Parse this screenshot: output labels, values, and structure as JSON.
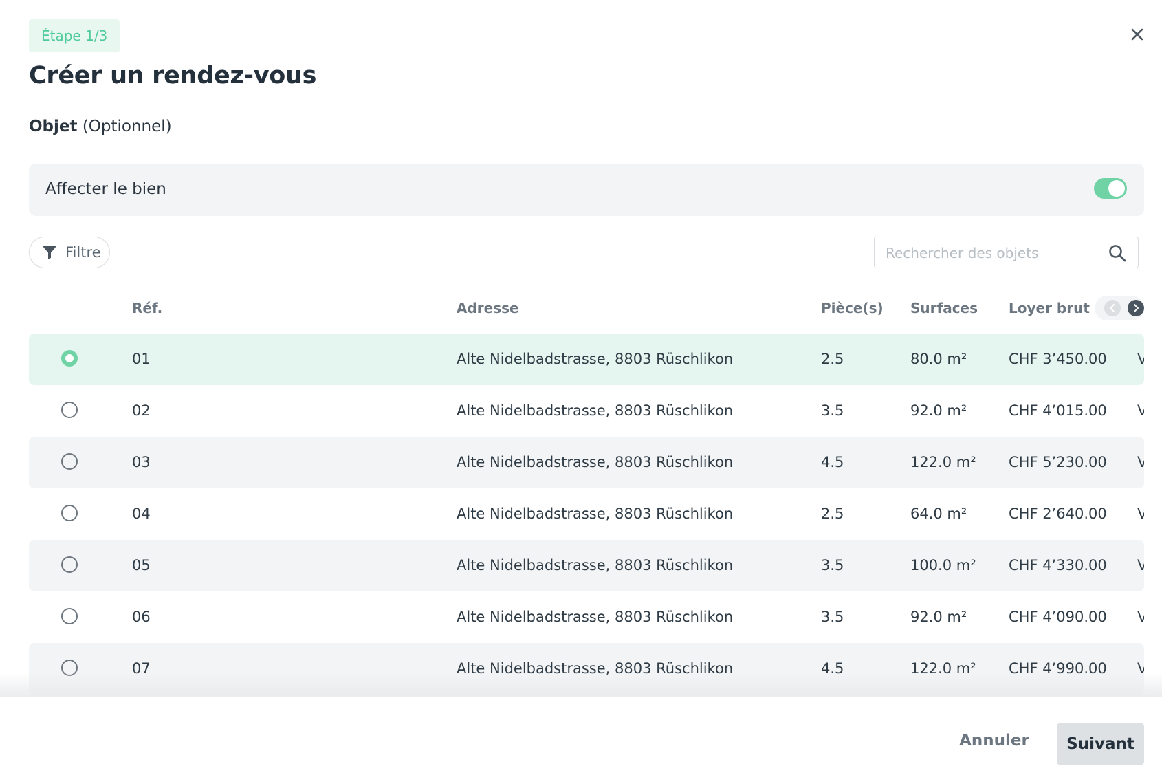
{
  "modal": {
    "step": "Étape 1/3",
    "title": "Créer un rendez-vous",
    "section_label_strong": "Objet",
    "section_label_rest": "(Optionnel)"
  },
  "assign": {
    "label": "Affecter le bien",
    "enabled": true
  },
  "toolbar": {
    "filter_label": "Filtre",
    "search_placeholder": "Rechercher des objets"
  },
  "table": {
    "headers": {
      "ref": "Réf.",
      "address": "Adresse",
      "rooms": "Pièce(s)",
      "surface": "Surfaces",
      "rent": "Loyer brut",
      "truncated": "\\"
    },
    "rows": [
      {
        "ref": "01",
        "address": "Alte Nidelbadstrasse, 8803 Rüschlikon",
        "rooms": "2.5",
        "surface": "80.0 m²",
        "rent": "CHF 3’450.00",
        "truncated": "V",
        "selected": true
      },
      {
        "ref": "02",
        "address": "Alte Nidelbadstrasse, 8803 Rüschlikon",
        "rooms": "3.5",
        "surface": "92.0 m²",
        "rent": "CHF 4’015.00",
        "truncated": "V",
        "selected": false
      },
      {
        "ref": "03",
        "address": "Alte Nidelbadstrasse, 8803 Rüschlikon",
        "rooms": "4.5",
        "surface": "122.0 m²",
        "rent": "CHF 5’230.00",
        "truncated": "V",
        "selected": false
      },
      {
        "ref": "04",
        "address": "Alte Nidelbadstrasse, 8803 Rüschlikon",
        "rooms": "2.5",
        "surface": "64.0 m²",
        "rent": "CHF 2’640.00",
        "truncated": "V",
        "selected": false
      },
      {
        "ref": "05",
        "address": "Alte Nidelbadstrasse, 8803 Rüschlikon",
        "rooms": "3.5",
        "surface": "100.0 m²",
        "rent": "CHF 4’330.00",
        "truncated": "V",
        "selected": false
      },
      {
        "ref": "06",
        "address": "Alte Nidelbadstrasse, 8803 Rüschlikon",
        "rooms": "3.5",
        "surface": "92.0 m²",
        "rent": "CHF 4’090.00",
        "truncated": "V",
        "selected": false
      },
      {
        "ref": "07",
        "address": "Alte Nidelbadstrasse, 8803 Rüschlikon",
        "rooms": "4.5",
        "surface": "122.0 m²",
        "rent": "CHF 4’990.00",
        "truncated": "V",
        "selected": false
      }
    ]
  },
  "footer": {
    "cancel_label": "Annuler",
    "next_label": "Suivant"
  },
  "colors": {
    "accent": "#6fd3a6",
    "step_text": "#4fcb9a",
    "selected_row": "#e4f6ef",
    "alt_row": "#f3f4f5"
  }
}
